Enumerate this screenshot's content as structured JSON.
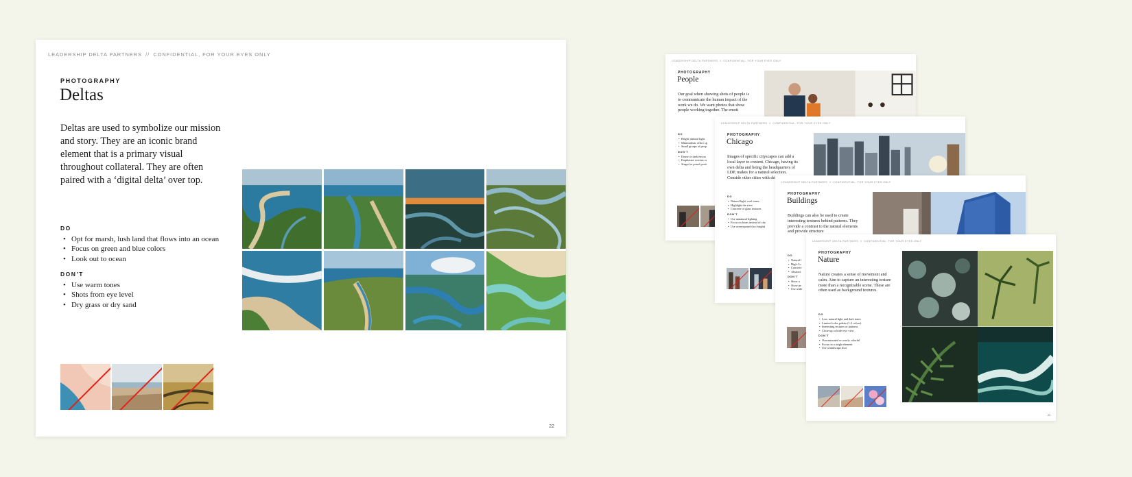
{
  "colors": {
    "background": "#f4f5ea",
    "page": "#ffffff",
    "strike": "#e2231a"
  },
  "main": {
    "header": {
      "org": "LEADERSHIP DELTA PARTNERS",
      "separator": "//",
      "note": "CONFIDENTIAL, FOR YOUR EYES ONLY"
    },
    "eyebrow": "PHOTOGRAPHY",
    "title": "Deltas",
    "intro": "Deltas are used to symbolize our mission and story. They are an iconic brand element that is a primary visual throughout collateral. They are often paired with a ‘digital delta’ over top.",
    "do_label": "DO",
    "do_items": [
      "Opt for marsh, lush land that flows into an ocean",
      "Focus on green and blue colors",
      "Look out to ocean"
    ],
    "dont_label": "DON’T",
    "dont_items": [
      "Use warm tones",
      "Shots from eye level",
      "Dry grass or dry sand"
    ],
    "page_number": "22"
  },
  "thumbs": {
    "people": {
      "header": {
        "org": "LEADERSHIP DELTA PARTNERS",
        "separator": "//",
        "note": "CONFIDENTIAL, FOR YOUR EYES ONLY"
      },
      "eyebrow": "PHOTOGRAPHY",
      "title": "People",
      "intro": "Our goal when showing shots of people is to communicate the human impact of the work we do. We want photos that show people working together. The emoti",
      "do_label": "DO",
      "do_items": [
        "Bright, natural light",
        "Minimalistic office sp",
        "Small groups of peop"
      ],
      "dont_label": "DON’T",
      "dont_items": [
        "Dense or dark enviro",
        "Emphasize screens or",
        "Staged or posed posit"
      ]
    },
    "chicago": {
      "header": {
        "org": "LEADERSHIP DELTA PARTNERS",
        "separator": "//",
        "note": "CONFIDENTIAL, FOR YOUR EYES ONLY"
      },
      "eyebrow": "PHOTOGRAPHY",
      "title": "Chicago",
      "intro": "Images of specific cityscapes can add a local layer to content. Chicago, having its own delta and being the headquarters of LDP, makes for a natural selection. Conside other cities with deltas to",
      "do_label": "DO",
      "do_items": [
        "Natural light, cool tones",
        "Highlight the river",
        "Concrete or glass textures"
      ],
      "dont_label": "DON’T",
      "dont_items": [
        "Use unnatural lighting",
        "Focus on boats instead of city",
        "Use overexposed (too bright)"
      ]
    },
    "buildings": {
      "header": {
        "org": "LEADERSHIP DELTA PARTNERS",
        "separator": "//",
        "note": "CONFIDENTIAL, FOR YOUR EYES ONLY"
      },
      "eyebrow": "PHOTOGRAPHY",
      "title": "Buildings",
      "intro": "Buildings can also be used to create interesting textures behind patterns. They provide a contrast to the natural elements and provide structure",
      "do_label": "DO",
      "do_items": [
        "Natural l",
        "High Co",
        "Concrete",
        "Abstract"
      ],
      "dont_label": "DON’T",
      "dont_items": [
        "Show a",
        "Show pe",
        "Use wide"
      ]
    },
    "nature": {
      "header": {
        "org": "LEADERSHIP DELTA PARTNERS",
        "separator": "//",
        "note": "CONFIDENTIAL, FOR YOUR EYES ONLY"
      },
      "eyebrow": "PHOTOGRAPHY",
      "title": "Nature",
      "intro": "Nature creates a sense of movement and calm. Aim to capture an interesting texture more than a recognizable scene. These are often used as background textures.",
      "do_label": "DO",
      "do_items": [
        "Low, natural light and dark tones",
        "Limited color palette (1-2 colors)",
        "Interesting textures or patterns",
        "Close-up or birds-eye view"
      ],
      "dont_label": "DON’T",
      "dont_items": [
        "Oversaturated or overly colorful",
        "Focus on a single element",
        "Use a landscape shot"
      ],
      "page_number": "23"
    }
  }
}
